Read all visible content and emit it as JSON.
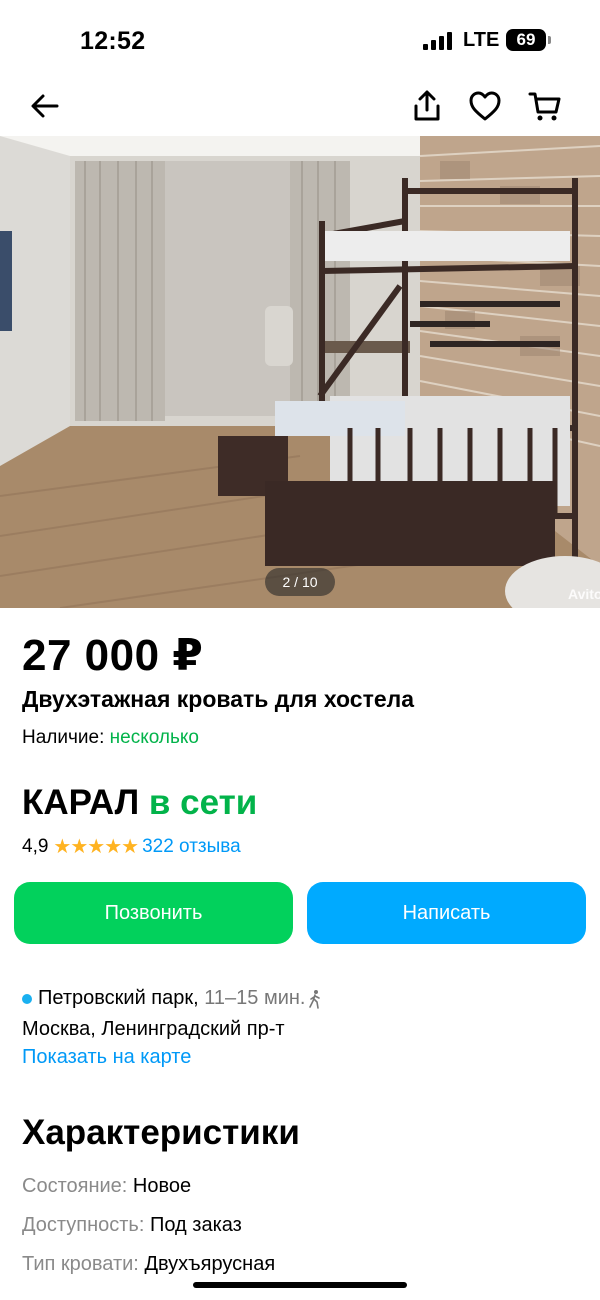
{
  "status_bar": {
    "time": "12:52",
    "network": "LTE",
    "battery": "69"
  },
  "nav": {
    "back_icon": "arrow-left-icon",
    "share_icon": "share-icon",
    "favorite_icon": "heart-icon",
    "cart_icon": "cart-icon"
  },
  "gallery": {
    "counter": "2 / 10",
    "watermark": "Avito"
  },
  "listing": {
    "price": "27 000 ₽",
    "title": "Двухэтажная кровать для хостела",
    "availability_label": "Наличие:",
    "availability_value": "несколько"
  },
  "seller": {
    "name": "КАРАЛ",
    "status": "в сети",
    "rating": "4,9",
    "stars": "★★★★★",
    "reviews": "322 отзыва"
  },
  "actions": {
    "call_label": "Позвонить",
    "message_label": "Написать"
  },
  "location": {
    "metro": "Петровский парк,",
    "walk_time": "11–15 мин.",
    "address": "Москва, Ленинградский пр-т",
    "map_link": "Показать на карте"
  },
  "specs": {
    "heading": "Характеристики",
    "items": [
      {
        "key": "Состояние:",
        "value": "Новое"
      },
      {
        "key": "Доступность:",
        "value": "Под заказ"
      },
      {
        "key": "Тип кровати:",
        "value": "Двухъярусная"
      }
    ]
  },
  "colors": {
    "green": "#02d15c",
    "blue": "#00aaff",
    "online_green": "#02b34a",
    "link_blue": "#0099f7",
    "star": "#ffb321"
  }
}
